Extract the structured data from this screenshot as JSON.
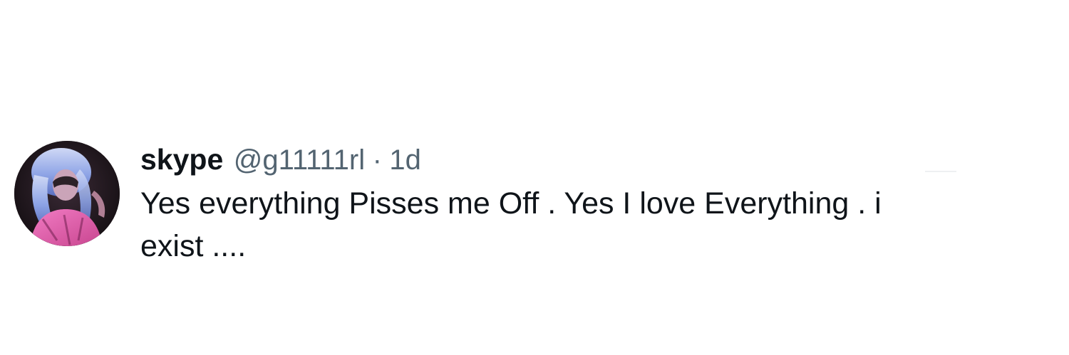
{
  "post": {
    "display_name": "skype",
    "handle": "@g11111rl",
    "separator": "·",
    "age": "1d",
    "text_line_1": "Yes everything Pisses me Off . Yes I love Everything . i",
    "text_line_2": "exist ...."
  },
  "colors": {
    "name": "#0f1419",
    "secondary": "#536471",
    "background": "#ffffff"
  },
  "icons": {
    "avatar": "profile-photo-blue-hair-pink-top"
  }
}
